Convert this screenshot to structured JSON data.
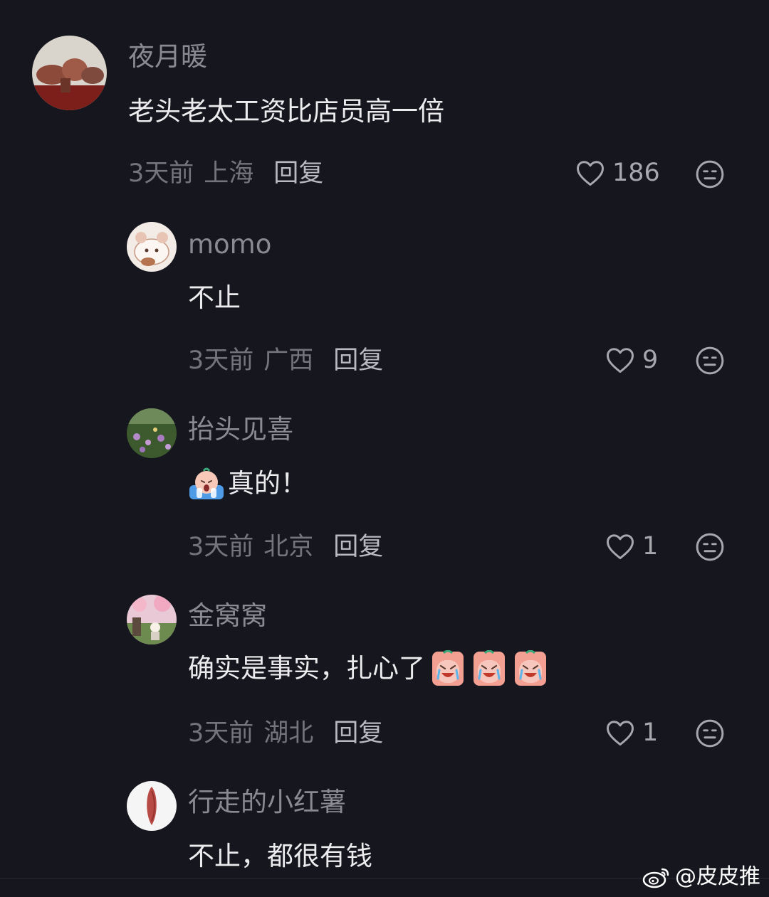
{
  "comments": [
    {
      "username": "夜月暖",
      "text": "老头老太工资比店员高一倍",
      "time": "3天前",
      "location": "上海",
      "reply_label": "回复",
      "likes": "186"
    },
    {
      "username": "momo",
      "text": "不止",
      "time": "3天前",
      "location": "广西",
      "reply_label": "回复",
      "likes": "9"
    },
    {
      "username": "抬头见喜",
      "text": "真的！",
      "time": "3天前",
      "location": "北京",
      "reply_label": "回复",
      "likes": "1"
    },
    {
      "username": "金窝窝",
      "text": "确实是事实，扎心了",
      "time": "3天前",
      "location": "湖北",
      "reply_label": "回复",
      "likes": "1"
    },
    {
      "username": "行走的小红薯",
      "text": "不止，都很有钱"
    }
  ],
  "watermark": {
    "text": "@皮皮推"
  },
  "icons": {
    "like": "heart-outline-icon",
    "dislike": "meh-face-icon",
    "crying_emoji": "crying-peach-emoji",
    "weibo": "weibo-logo-icon"
  },
  "colors": {
    "background": "#16161e",
    "username": "#8a8a93",
    "text": "#ececef",
    "meta": "#74747d"
  }
}
